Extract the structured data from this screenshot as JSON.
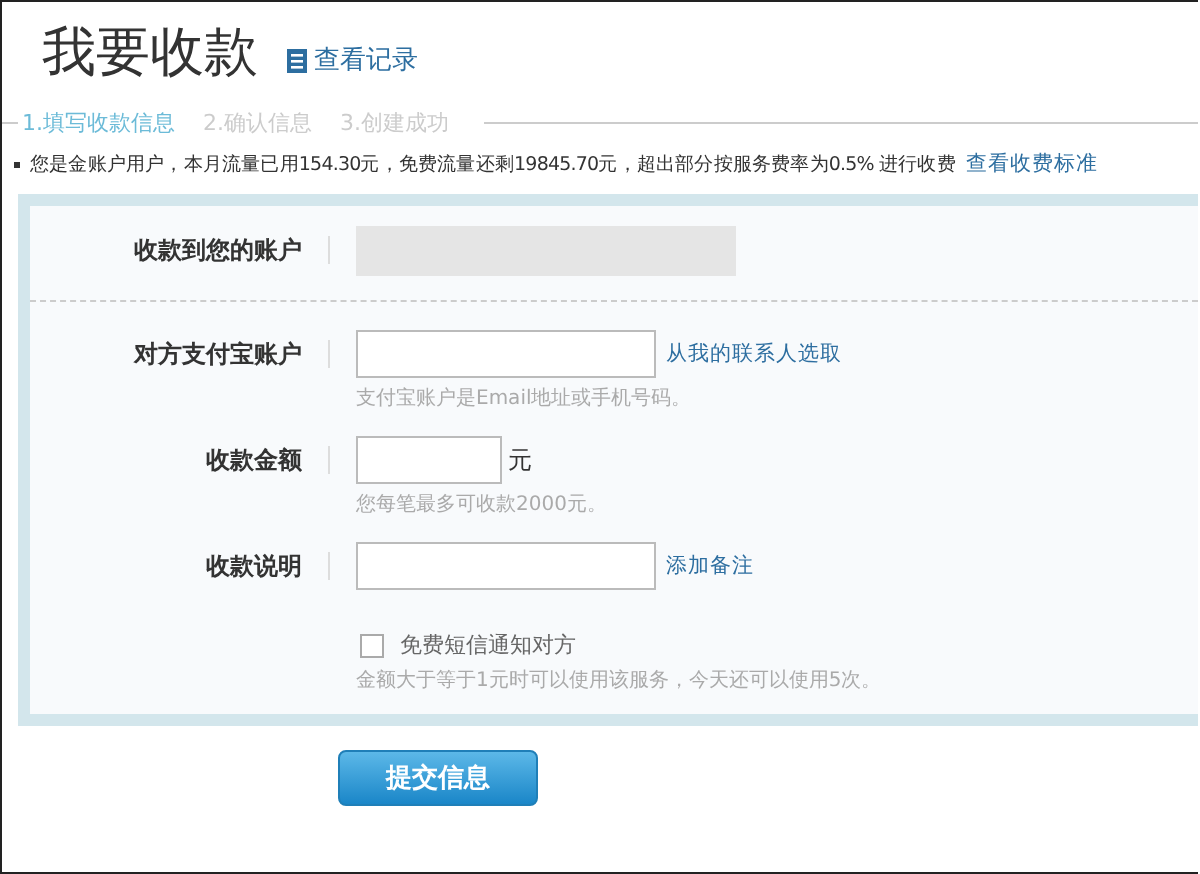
{
  "header": {
    "title": "我要收款",
    "records_link": "查看记录"
  },
  "steps": [
    {
      "label": "1.填写收款信息",
      "selected": true
    },
    {
      "label": "2.确认信息",
      "selected": false
    },
    {
      "label": "3.创建成功",
      "selected": false
    }
  ],
  "notice": {
    "text": "您是金账户用户，本月流量已用154.30元，免费流量还剩19845.70元，超出部分按服务费率为0.5% 进行收费",
    "link": "查看收费标准"
  },
  "form": {
    "rows": [
      {
        "kind": "masked",
        "label": "收款到您的账户"
      },
      {
        "kind": "input",
        "label": "对方支付宝账户",
        "link": "从我的联系人选取",
        "hint": "支付宝账户是Email地址或手机号码。"
      },
      {
        "kind": "amount",
        "label": "收款金额",
        "unit": "元",
        "hint": "您每笔最多可收款2000元。"
      },
      {
        "kind": "input",
        "label": "收款说明",
        "link": "添加备注"
      }
    ],
    "sms": {
      "label": "免费短信通知对方",
      "checked": false,
      "hint": "金额大于等于1元时可以使用该服务，今天还可以使用5次。"
    }
  },
  "submit": "提交信息"
}
